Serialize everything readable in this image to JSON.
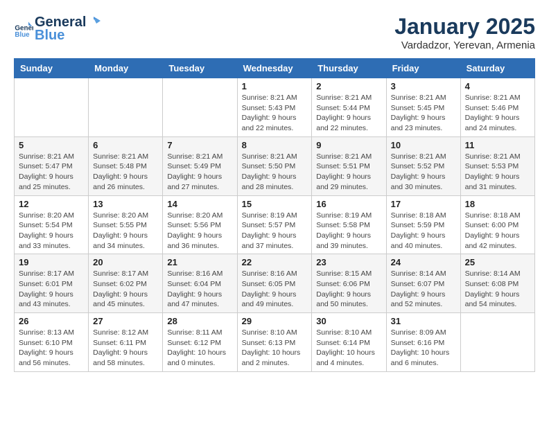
{
  "logo": {
    "line1": "General",
    "line2": "Blue"
  },
  "title": "January 2025",
  "subtitle": "Vardadzor, Yerevan, Armenia",
  "weekdays": [
    "Sunday",
    "Monday",
    "Tuesday",
    "Wednesday",
    "Thursday",
    "Friday",
    "Saturday"
  ],
  "weeks": [
    [
      {
        "day": "",
        "info": ""
      },
      {
        "day": "",
        "info": ""
      },
      {
        "day": "",
        "info": ""
      },
      {
        "day": "1",
        "info": "Sunrise: 8:21 AM\nSunset: 5:43 PM\nDaylight: 9 hours\nand 22 minutes."
      },
      {
        "day": "2",
        "info": "Sunrise: 8:21 AM\nSunset: 5:44 PM\nDaylight: 9 hours\nand 22 minutes."
      },
      {
        "day": "3",
        "info": "Sunrise: 8:21 AM\nSunset: 5:45 PM\nDaylight: 9 hours\nand 23 minutes."
      },
      {
        "day": "4",
        "info": "Sunrise: 8:21 AM\nSunset: 5:46 PM\nDaylight: 9 hours\nand 24 minutes."
      }
    ],
    [
      {
        "day": "5",
        "info": "Sunrise: 8:21 AM\nSunset: 5:47 PM\nDaylight: 9 hours\nand 25 minutes."
      },
      {
        "day": "6",
        "info": "Sunrise: 8:21 AM\nSunset: 5:48 PM\nDaylight: 9 hours\nand 26 minutes."
      },
      {
        "day": "7",
        "info": "Sunrise: 8:21 AM\nSunset: 5:49 PM\nDaylight: 9 hours\nand 27 minutes."
      },
      {
        "day": "8",
        "info": "Sunrise: 8:21 AM\nSunset: 5:50 PM\nDaylight: 9 hours\nand 28 minutes."
      },
      {
        "day": "9",
        "info": "Sunrise: 8:21 AM\nSunset: 5:51 PM\nDaylight: 9 hours\nand 29 minutes."
      },
      {
        "day": "10",
        "info": "Sunrise: 8:21 AM\nSunset: 5:52 PM\nDaylight: 9 hours\nand 30 minutes."
      },
      {
        "day": "11",
        "info": "Sunrise: 8:21 AM\nSunset: 5:53 PM\nDaylight: 9 hours\nand 31 minutes."
      }
    ],
    [
      {
        "day": "12",
        "info": "Sunrise: 8:20 AM\nSunset: 5:54 PM\nDaylight: 9 hours\nand 33 minutes."
      },
      {
        "day": "13",
        "info": "Sunrise: 8:20 AM\nSunset: 5:55 PM\nDaylight: 9 hours\nand 34 minutes."
      },
      {
        "day": "14",
        "info": "Sunrise: 8:20 AM\nSunset: 5:56 PM\nDaylight: 9 hours\nand 36 minutes."
      },
      {
        "day": "15",
        "info": "Sunrise: 8:19 AM\nSunset: 5:57 PM\nDaylight: 9 hours\nand 37 minutes."
      },
      {
        "day": "16",
        "info": "Sunrise: 8:19 AM\nSunset: 5:58 PM\nDaylight: 9 hours\nand 39 minutes."
      },
      {
        "day": "17",
        "info": "Sunrise: 8:18 AM\nSunset: 5:59 PM\nDaylight: 9 hours\nand 40 minutes."
      },
      {
        "day": "18",
        "info": "Sunrise: 8:18 AM\nSunset: 6:00 PM\nDaylight: 9 hours\nand 42 minutes."
      }
    ],
    [
      {
        "day": "19",
        "info": "Sunrise: 8:17 AM\nSunset: 6:01 PM\nDaylight: 9 hours\nand 43 minutes."
      },
      {
        "day": "20",
        "info": "Sunrise: 8:17 AM\nSunset: 6:02 PM\nDaylight: 9 hours\nand 45 minutes."
      },
      {
        "day": "21",
        "info": "Sunrise: 8:16 AM\nSunset: 6:04 PM\nDaylight: 9 hours\nand 47 minutes."
      },
      {
        "day": "22",
        "info": "Sunrise: 8:16 AM\nSunset: 6:05 PM\nDaylight: 9 hours\nand 49 minutes."
      },
      {
        "day": "23",
        "info": "Sunrise: 8:15 AM\nSunset: 6:06 PM\nDaylight: 9 hours\nand 50 minutes."
      },
      {
        "day": "24",
        "info": "Sunrise: 8:14 AM\nSunset: 6:07 PM\nDaylight: 9 hours\nand 52 minutes."
      },
      {
        "day": "25",
        "info": "Sunrise: 8:14 AM\nSunset: 6:08 PM\nDaylight: 9 hours\nand 54 minutes."
      }
    ],
    [
      {
        "day": "26",
        "info": "Sunrise: 8:13 AM\nSunset: 6:10 PM\nDaylight: 9 hours\nand 56 minutes."
      },
      {
        "day": "27",
        "info": "Sunrise: 8:12 AM\nSunset: 6:11 PM\nDaylight: 9 hours\nand 58 minutes."
      },
      {
        "day": "28",
        "info": "Sunrise: 8:11 AM\nSunset: 6:12 PM\nDaylight: 10 hours\nand 0 minutes."
      },
      {
        "day": "29",
        "info": "Sunrise: 8:10 AM\nSunset: 6:13 PM\nDaylight: 10 hours\nand 2 minutes."
      },
      {
        "day": "30",
        "info": "Sunrise: 8:10 AM\nSunset: 6:14 PM\nDaylight: 10 hours\nand 4 minutes."
      },
      {
        "day": "31",
        "info": "Sunrise: 8:09 AM\nSunset: 6:16 PM\nDaylight: 10 hours\nand 6 minutes."
      },
      {
        "day": "",
        "info": ""
      }
    ]
  ]
}
